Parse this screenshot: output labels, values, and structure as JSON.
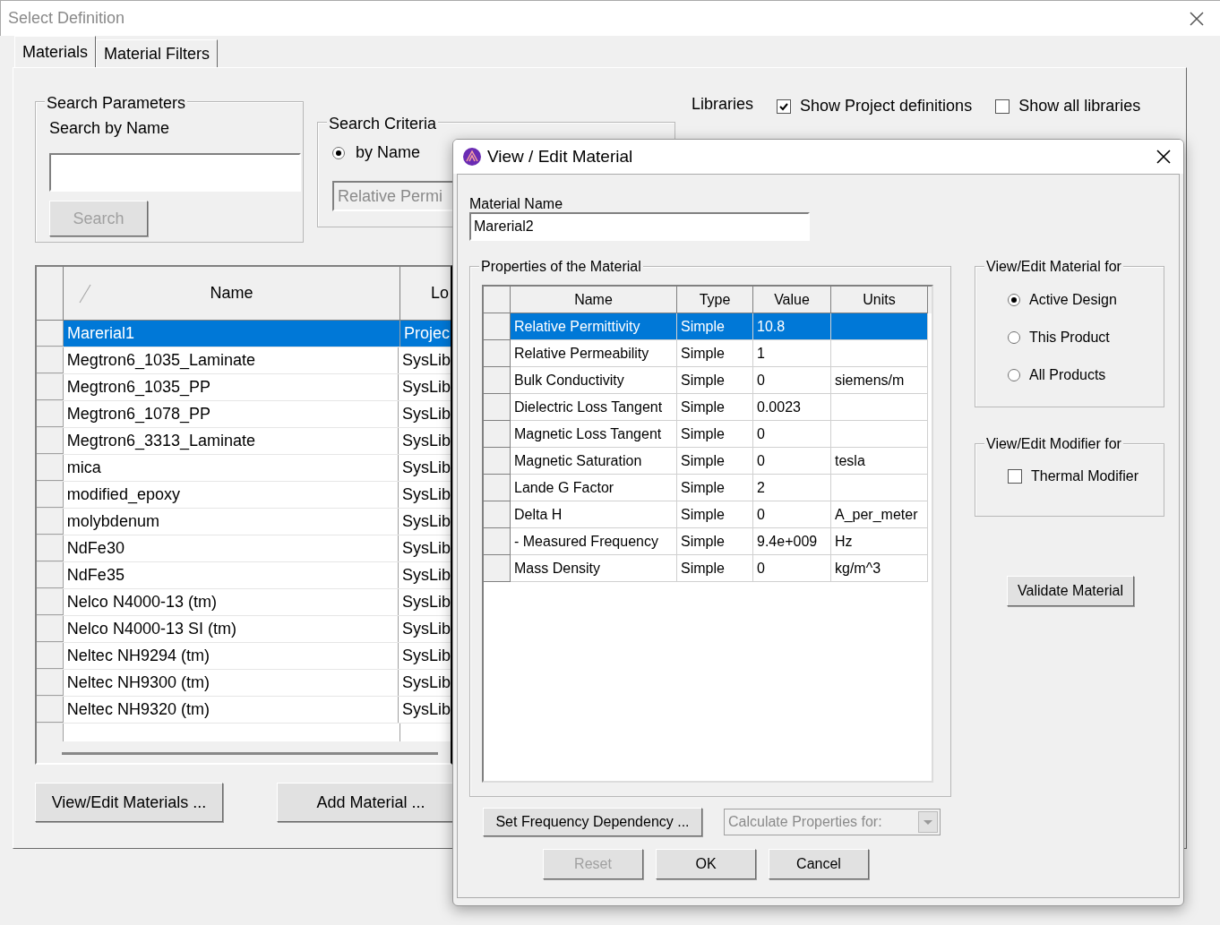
{
  "window": {
    "title": "Select Definition"
  },
  "tabs": [
    {
      "label": "Materials",
      "selected": true
    },
    {
      "label": "Material Filters",
      "selected": false
    }
  ],
  "search_parameters": {
    "title": "Search Parameters",
    "label": "Search by Name",
    "search_button": {
      "label": "Search",
      "disabled": true
    }
  },
  "search_criteria": {
    "title": "Search Criteria",
    "options": [
      {
        "label": "by Name",
        "selected": true
      }
    ],
    "dropdown": {
      "value": "Relative Permi",
      "disabled": true
    }
  },
  "libraries": {
    "label": "Libraries",
    "options": [
      {
        "label": "Show Project definitions",
        "checked": true
      },
      {
        "label": "Show all libraries",
        "checked": false
      }
    ]
  },
  "table": {
    "columns": [
      "Name",
      "Lo"
    ],
    "rows": [
      {
        "cells": [
          "Marerial1",
          "Projec"
        ],
        "selected": true
      },
      {
        "cells": [
          "Megtron6_1035_Laminate",
          "SysLib"
        ],
        "selected": false
      },
      {
        "cells": [
          "Megtron6_1035_PP",
          "SysLib"
        ],
        "selected": false
      },
      {
        "cells": [
          "Megtron6_1078_PP",
          "SysLib"
        ],
        "selected": false
      },
      {
        "cells": [
          "Megtron6_3313_Laminate",
          "SysLib"
        ],
        "selected": false
      },
      {
        "cells": [
          "mica",
          "SysLib"
        ],
        "selected": false
      },
      {
        "cells": [
          "modified_epoxy",
          "SysLib"
        ],
        "selected": false
      },
      {
        "cells": [
          "molybdenum",
          "SysLib"
        ],
        "selected": false
      },
      {
        "cells": [
          "NdFe30",
          "SysLib"
        ],
        "selected": false
      },
      {
        "cells": [
          "NdFe35",
          "SysLib"
        ],
        "selected": false
      },
      {
        "cells": [
          "Nelco N4000-13 (tm)",
          "SysLib"
        ],
        "selected": false
      },
      {
        "cells": [
          "Nelco N4000-13 SI (tm)",
          "SysLib"
        ],
        "selected": false
      },
      {
        "cells": [
          "Neltec NH9294 (tm)",
          "SysLib"
        ],
        "selected": false
      },
      {
        "cells": [
          "Neltec NH9300 (tm)",
          "SysLib"
        ],
        "selected": false
      },
      {
        "cells": [
          "Neltec NH9320 (tm)",
          "SysLib"
        ],
        "selected": false
      }
    ]
  },
  "buttons": [
    "View/Edit Materials ...",
    "Add Material ..."
  ],
  "dialog": {
    "title": "View / Edit Material",
    "material_name": {
      "label": "Material Name",
      "value": "Marerial2"
    },
    "properties": {
      "title": "Properties of the Material",
      "columns": [
        "Name",
        "Type",
        "Value",
        "Units"
      ],
      "rows": [
        {
          "cells": [
            "Relative Permittivity",
            "Simple",
            "10.8",
            ""
          ],
          "selected": true
        },
        {
          "cells": [
            "Relative Permeability",
            "Simple",
            "1",
            ""
          ],
          "selected": false
        },
        {
          "cells": [
            "Bulk Conductivity",
            "Simple",
            "0",
            "siemens/m"
          ],
          "selected": false
        },
        {
          "cells": [
            "Dielectric Loss Tangent",
            "Simple",
            "0.0023",
            ""
          ],
          "selected": false
        },
        {
          "cells": [
            "Magnetic Loss Tangent",
            "Simple",
            "0",
            ""
          ],
          "selected": false
        },
        {
          "cells": [
            "Magnetic Saturation",
            "Simple",
            "0",
            "tesla"
          ],
          "selected": false
        },
        {
          "cells": [
            "Lande G Factor",
            "Simple",
            "2",
            ""
          ],
          "selected": false
        },
        {
          "cells": [
            "Delta H",
            "Simple",
            "0",
            "A_per_meter"
          ],
          "selected": false
        },
        {
          "cells": [
            "- Measured Frequency",
            "Simple",
            "9.4e+009",
            "Hz"
          ],
          "selected": false
        },
        {
          "cells": [
            "Mass Density",
            "Simple",
            "0",
            "kg/m^3"
          ],
          "selected": false
        }
      ]
    },
    "view_for": {
      "title": "View/Edit Material for",
      "options": [
        {
          "label": "Active Design",
          "selected": true
        },
        {
          "label": "This Product",
          "selected": false
        },
        {
          "label": "All Products",
          "selected": false
        }
      ]
    },
    "modifier_for": {
      "title": "View/Edit Modifier for",
      "options": [
        {
          "label": "Thermal Modifier",
          "checked": false
        }
      ]
    },
    "validate_button": "Validate Material",
    "frequency_button": "Set Frequency Dependency ...",
    "calculate_dropdown": {
      "value": "Calculate Properties for:",
      "disabled": true
    },
    "buttons": [
      {
        "label": "Reset",
        "disabled": true
      },
      {
        "label": "OK",
        "disabled": false
      },
      {
        "label": "Cancel",
        "disabled": false
      }
    ]
  }
}
